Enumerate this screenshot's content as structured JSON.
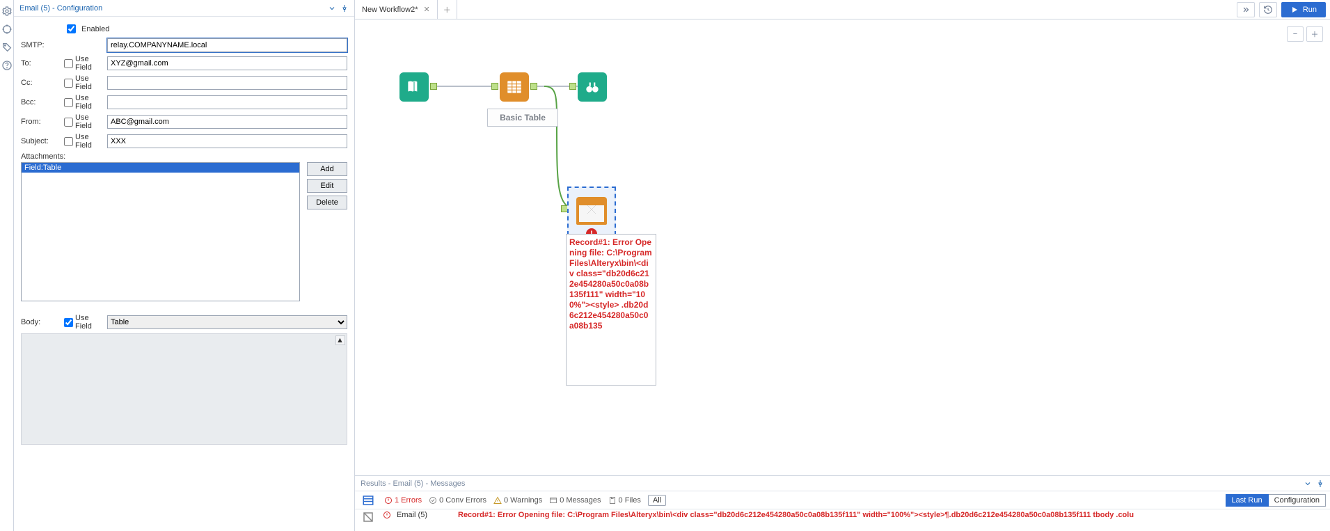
{
  "config_panel": {
    "title": "Email (5) - Configuration",
    "enabled_label": "Enabled",
    "enabled": true,
    "smtp_label": "SMTP:",
    "smtp_value": "relay.COMPANYNAME.local",
    "fields": {
      "to": {
        "label": "To:",
        "use_field": false,
        "use_field_label": "Use Field",
        "value": "XYZ@gmail.com"
      },
      "cc": {
        "label": "Cc:",
        "use_field": false,
        "use_field_label": "Use Field",
        "value": ""
      },
      "bcc": {
        "label": "Bcc:",
        "use_field": false,
        "use_field_label": "Use Field",
        "value": ""
      },
      "from": {
        "label": "From:",
        "use_field": false,
        "use_field_label": "Use Field",
        "value": "ABC@gmail.com"
      },
      "subj": {
        "label": "Subject:",
        "use_field": false,
        "use_field_label": "Use Field",
        "value": "XXX"
      }
    },
    "attachments_label": "Attachments:",
    "attachment_selected": "Field:Table",
    "btn_add": "Add",
    "btn_edit": "Edit",
    "btn_delete": "Delete",
    "body_label": "Body:",
    "body_use_field": true,
    "body_use_field_label": "Use Field",
    "body_field_value": "Table"
  },
  "workflow": {
    "tab_name": "New Workflow2*",
    "run_label": "Run",
    "basic_table_label": "Basic Table",
    "error_text": "Record#1: Error Opening file: C:\\Program Files\\Alteryx\\bin\\<div class=\"db20d6c212e454280a50c0a08b135f111\" width=\"100%\"><style> .db20d6c212e454280a50c0a08b135"
  },
  "results": {
    "title": "Results - Email (5) - Messages",
    "errors": "1 Errors",
    "conv": "0 Conv Errors",
    "warn": "0 Warnings",
    "msgs": "0 Messages",
    "files": "0 Files",
    "all": "All",
    "lastrun": "Last Run",
    "config": "Configuration",
    "row_source": "Email (5)",
    "row_msg": "Record#1: Error Opening file: C:\\Program Files\\Alteryx\\bin\\<div class=\"db20d6c212e454280a50c0a08b135f111\" width=\"100%\"><style>¶.db20d6c212e454280a50c0a08b135f111 tbody .colu"
  }
}
